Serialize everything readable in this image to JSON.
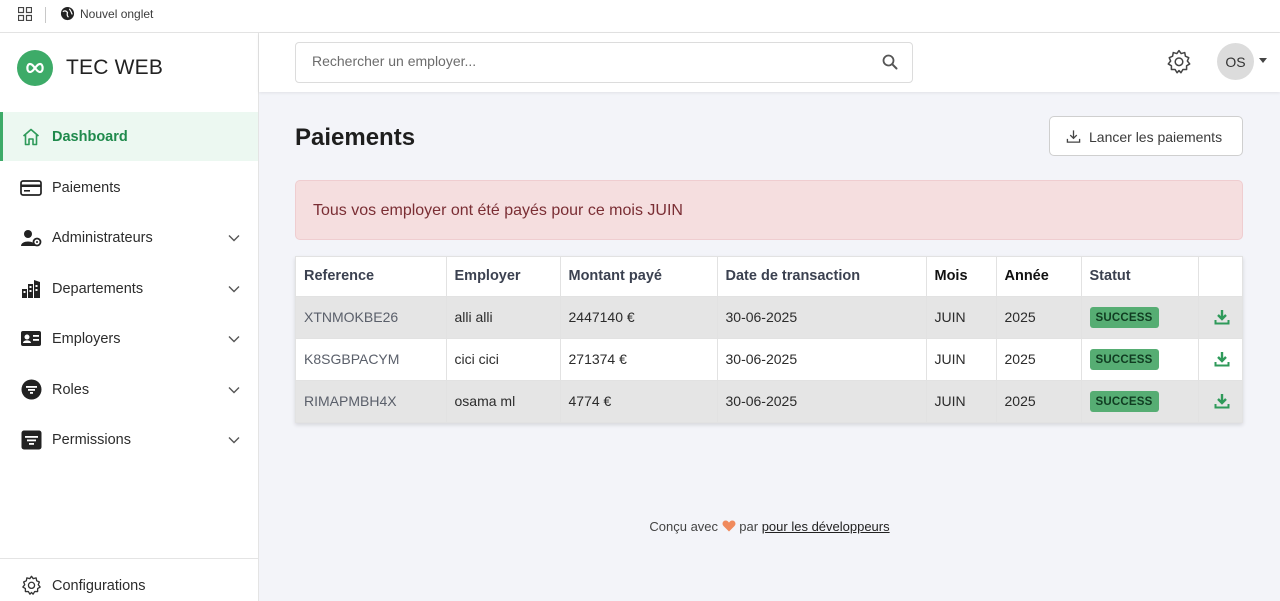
{
  "browser": {
    "tab_title": "Nouvel onglet"
  },
  "brand": {
    "name": "TEC WEB"
  },
  "sidebar": {
    "items": [
      {
        "label": "Dashboard",
        "icon": "home-icon",
        "active": true,
        "expandable": false
      },
      {
        "label": "Paiements",
        "icon": "credit-card-icon",
        "active": false,
        "expandable": false
      },
      {
        "label": "Administrateurs",
        "icon": "user-gear-icon",
        "active": false,
        "expandable": true
      },
      {
        "label": "Departements",
        "icon": "building-icon",
        "active": false,
        "expandable": true
      },
      {
        "label": "Employers",
        "icon": "id-card-icon",
        "active": false,
        "expandable": true
      },
      {
        "label": "Roles",
        "icon": "filter-circle-icon",
        "active": false,
        "expandable": true
      },
      {
        "label": "Permissions",
        "icon": "filter-square-icon",
        "active": false,
        "expandable": true
      }
    ],
    "bottom": {
      "label": "Configurations",
      "icon": "gear-icon"
    }
  },
  "topbar": {
    "search_placeholder": "Rechercher un employer...",
    "avatar_initials": "OS"
  },
  "page": {
    "title": "Paiements",
    "launch_button": "Lancer les paiements",
    "alert": "Tous vos employer ont été payés pour ce mois JUIN"
  },
  "table": {
    "headers": [
      "Reference",
      "Employer",
      "Montant payé",
      "Date de transaction",
      "Mois",
      "Année",
      "Statut",
      ""
    ],
    "rows": [
      {
        "reference": "XTNMOKBE26",
        "employer": "alli alli",
        "amount": "2447140 €",
        "date": "30-06-2025",
        "month": "JUIN",
        "year": "2025",
        "status": "SUCCESS"
      },
      {
        "reference": "K8SGBPACYM",
        "employer": "cici cici",
        "amount": "271374 €",
        "date": "30-06-2025",
        "month": "JUIN",
        "year": "2025",
        "status": "SUCCESS"
      },
      {
        "reference": "RIMAPMBH4X",
        "employer": "osama ml",
        "amount": "4774 €",
        "date": "30-06-2025",
        "month": "JUIN",
        "year": "2025",
        "status": "SUCCESS"
      }
    ]
  },
  "footer": {
    "prefix": "Conçu avec",
    "middle": "par",
    "link": "pour les développeurs"
  },
  "colors": {
    "accent": "#3dab68",
    "badge": "#56ad73",
    "alert_bg": "#f5dedf",
    "alert_text": "#7a2e34"
  }
}
